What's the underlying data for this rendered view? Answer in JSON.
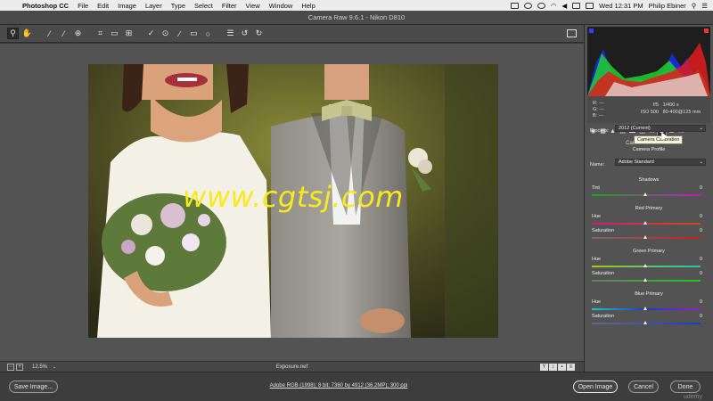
{
  "menubar": {
    "app": "Photoshop CC",
    "items": [
      "File",
      "Edit",
      "Image",
      "Layer",
      "Type",
      "Select",
      "Filter",
      "View",
      "Window",
      "Help"
    ],
    "datetime": "Wed 12:31 PM",
    "user": "Philip Ebiner"
  },
  "window": {
    "title": "Camera Raw 9.6.1  -  Nikon D810"
  },
  "canvas": {
    "watermark": "www.cgtsj.com"
  },
  "status": {
    "zoom": "12.5%",
    "filename": "Exposure.nef"
  },
  "histogram": {
    "r": "R:",
    "g": "G:",
    "b": "B:",
    "dash": "---",
    "aperture": "f/5",
    "shutter": "1/400 s",
    "iso": "ISO 500",
    "lens": "80-400@125 mm"
  },
  "tooltip": "Camera Calibration",
  "panel": {
    "header": "Camera Calibration",
    "process_label": "Process:",
    "process_value": "2012 (Current)",
    "profile_header": "Camera Profile",
    "name_label": "Name:",
    "name_value": "Adobe Standard",
    "shadows": {
      "title": "Shadows",
      "tint_label": "Tint",
      "tint_value": "0"
    },
    "red": {
      "title": "Red Primary",
      "hue_label": "Hue",
      "hue_value": "0",
      "sat_label": "Saturation",
      "sat_value": "0"
    },
    "green": {
      "title": "Green Primary",
      "hue_label": "Hue",
      "hue_value": "0",
      "sat_label": "Saturation",
      "sat_value": "0"
    },
    "blue": {
      "title": "Blue Primary",
      "hue_label": "Hue",
      "hue_value": "0",
      "sat_label": "Saturation",
      "sat_value": "0"
    }
  },
  "footer": {
    "save": "Save Image...",
    "workflow": "Adobe RGB (1998); 8 bit; 7360 by 4912 (36.2MP); 300 ppi",
    "open": "Open Image",
    "cancel": "Cancel",
    "done": "Done",
    "brand": "udemy"
  },
  "colors": {
    "watermark": "#f7ea1b",
    "panel_bg": "#535353",
    "canvas_bg": "#535353"
  }
}
